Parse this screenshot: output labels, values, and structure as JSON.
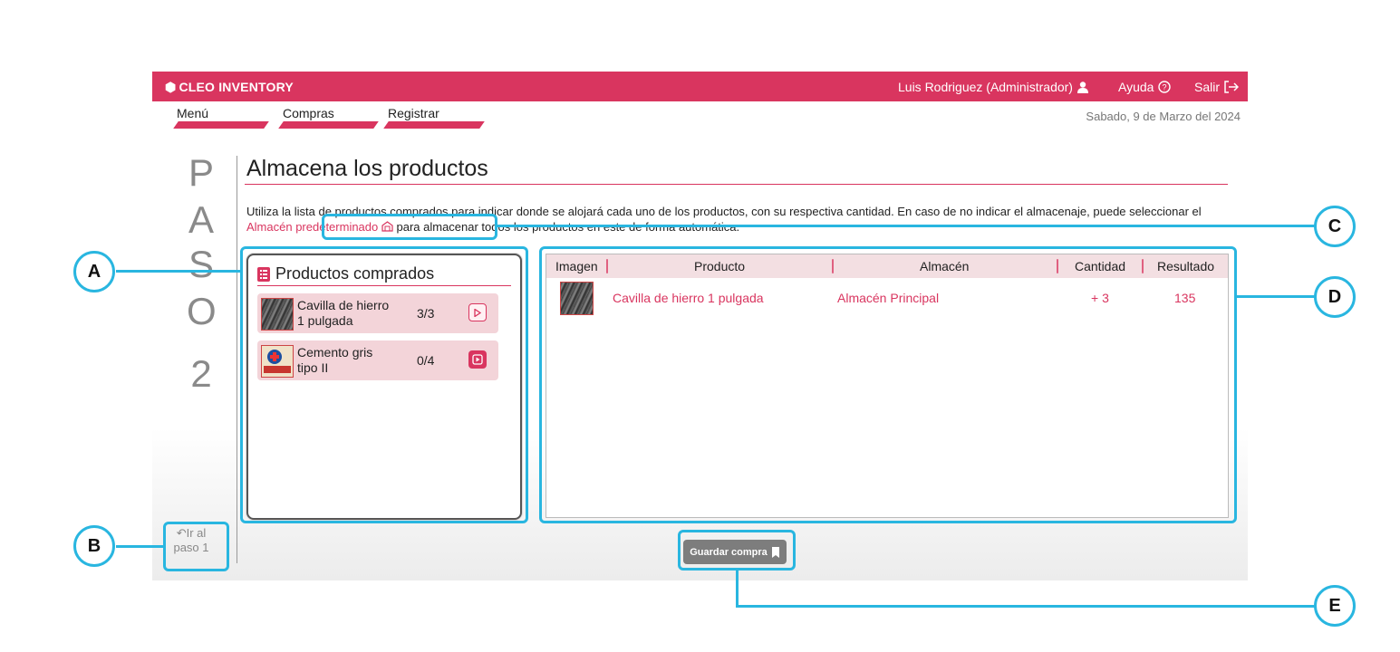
{
  "header": {
    "brand": "CLEO INVENTORY",
    "user": "Luis Rodriguez (Administrador)",
    "help": "Ayuda",
    "logout": "Salir"
  },
  "tabs": [
    {
      "label": "Menú"
    },
    {
      "label": "Compras"
    },
    {
      "label": "Registrar"
    }
  ],
  "date": "Sabado, 9 de Marzo del 2024",
  "step": {
    "letters": [
      "P",
      "A",
      "S",
      "O"
    ],
    "number": "2",
    "back_line1": "Ir al",
    "back_line2": "paso 1"
  },
  "page": {
    "title": "Almacena los productos",
    "desc_before": "Utiliza la lista de productos comprados para indicar donde se alojará cada uno de los productos, con su respectiva cantidad. En caso de no indicar el almacenaje, puede seleccionar el ",
    "desc_link": "Almacén predeterminado",
    "desc_after": " para almacenar todos los productos en este de forma automática."
  },
  "purchased": {
    "title": "Productos comprados",
    "items": [
      {
        "name_line1": "Cavilla de hierro",
        "name_line2": "1 pulgada",
        "count": "3/3",
        "done": true
      },
      {
        "name_line1": "Cemento gris",
        "name_line2": "tipo II",
        "count": "0/4",
        "done": false
      }
    ]
  },
  "table": {
    "headers": [
      "Imagen",
      "Producto",
      "Almacén",
      "Cantidad",
      "Resultado"
    ],
    "rows": [
      {
        "producto": "Cavilla de hierro 1 pulgada",
        "almacen": "Almacén Principal",
        "cantidad": "+ 3",
        "resultado": "135"
      }
    ]
  },
  "save_label": "Guardar compra",
  "callouts": [
    "A",
    "B",
    "C",
    "D",
    "E"
  ],
  "colors": {
    "brand": "#d9355f",
    "callout": "#29b6e0"
  }
}
